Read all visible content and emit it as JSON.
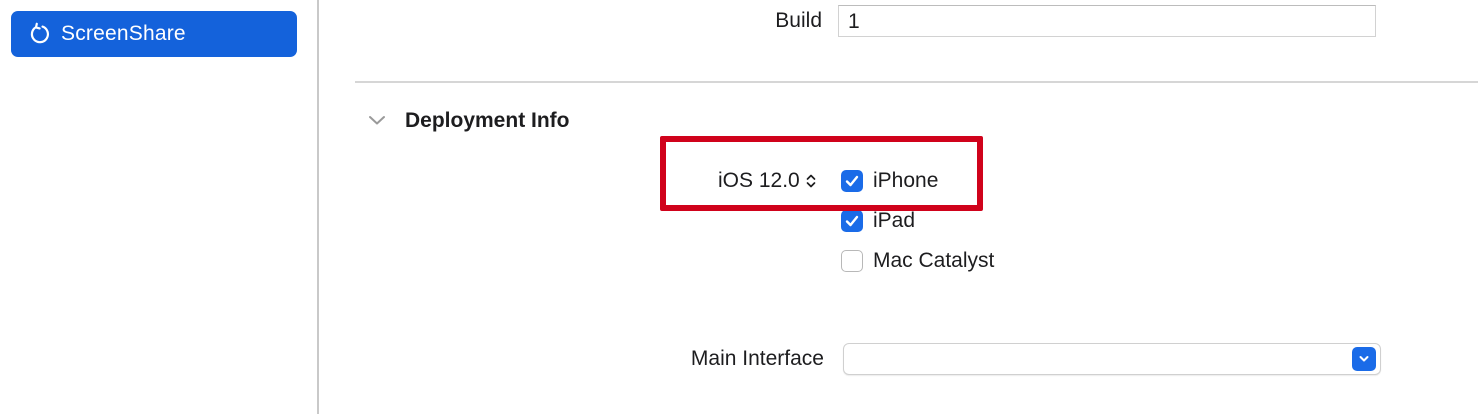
{
  "sidebar": {
    "target": {
      "label": "ScreenShare",
      "icon": "refresh-icon",
      "selected": true
    }
  },
  "identity": {
    "build_label": "Build",
    "build_value": "1"
  },
  "deployment": {
    "section_title": "Deployment Info",
    "ios_version": "iOS 12.0",
    "devices": [
      {
        "label": "iPhone",
        "checked": true
      },
      {
        "label": "iPad",
        "checked": true
      },
      {
        "label": "Mac Catalyst",
        "checked": false
      }
    ],
    "main_interface_label": "Main Interface",
    "main_interface_value": ""
  },
  "colors": {
    "accent": "#1a6be8",
    "sidebar_selection": "#1462db",
    "highlight": "#d0021b"
  }
}
